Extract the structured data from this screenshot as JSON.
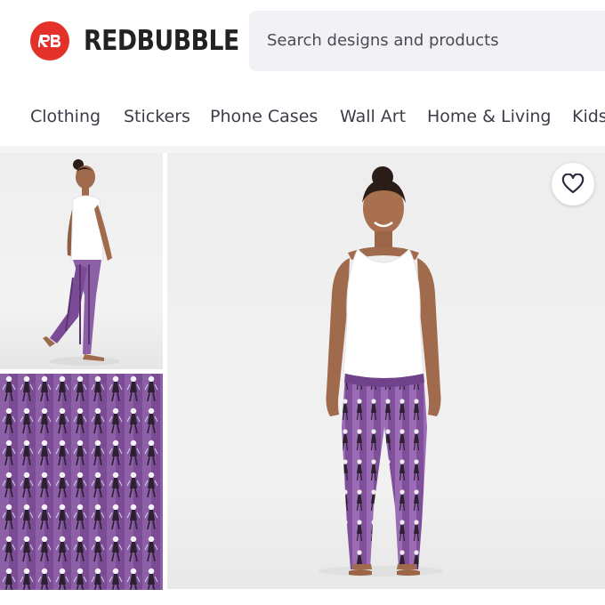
{
  "header": {
    "logo_text": "REDBUBBLE",
    "search": {
      "placeholder": "Search designs and products"
    }
  },
  "nav": {
    "items": [
      "Clothing",
      "Stickers",
      "Phone Cases",
      "Wall Art",
      "Home & Living",
      "Kids"
    ]
  },
  "gallery": {
    "thumbnails": [
      {
        "name": "side-view-model"
      },
      {
        "name": "pattern-swatch"
      }
    ],
    "main": {
      "name": "front-view-model"
    },
    "favorite_icon": "heart-outline-icon"
  },
  "colors": {
    "brand": "#e4322b",
    "legging_purple": "#8d5fa6",
    "search_bg": "#f2f2f6"
  }
}
